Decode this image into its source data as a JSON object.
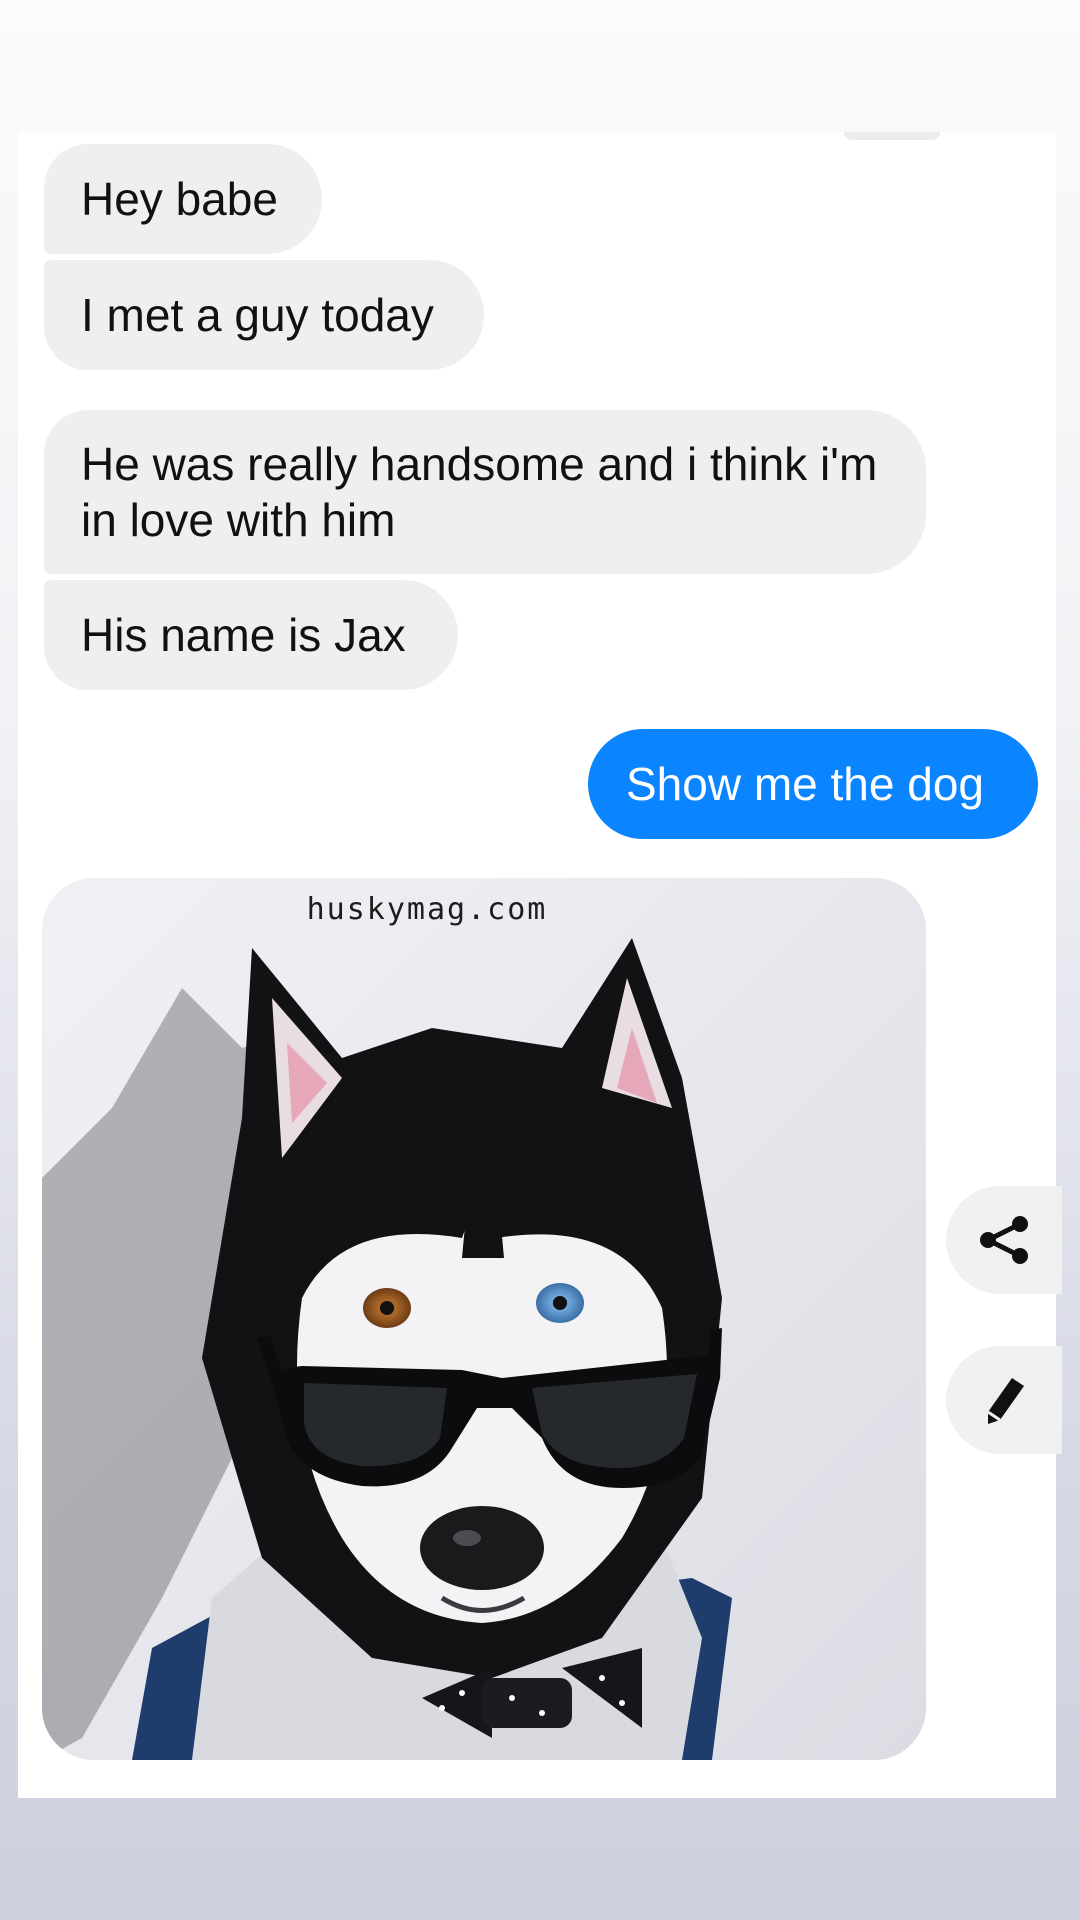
{
  "messages": [
    {
      "direction": "incoming",
      "text": "Hey babe"
    },
    {
      "direction": "incoming",
      "text": "I met a guy today"
    },
    {
      "direction": "incoming",
      "text": "He was really handsome and i think i'm in love with him"
    },
    {
      "direction": "incoming",
      "text": "His name is Jax"
    },
    {
      "direction": "outgoing",
      "text": "Show me the dog"
    }
  ],
  "photo": {
    "watermark": "huskymag.com"
  },
  "actions": {
    "share_icon": "share-icon",
    "edit_icon": "pencil-icon",
    "react_icon": "add-reaction-icon"
  },
  "colors": {
    "outgoing_bubble": "#0a84ff",
    "incoming_bubble": "#efeff1"
  }
}
